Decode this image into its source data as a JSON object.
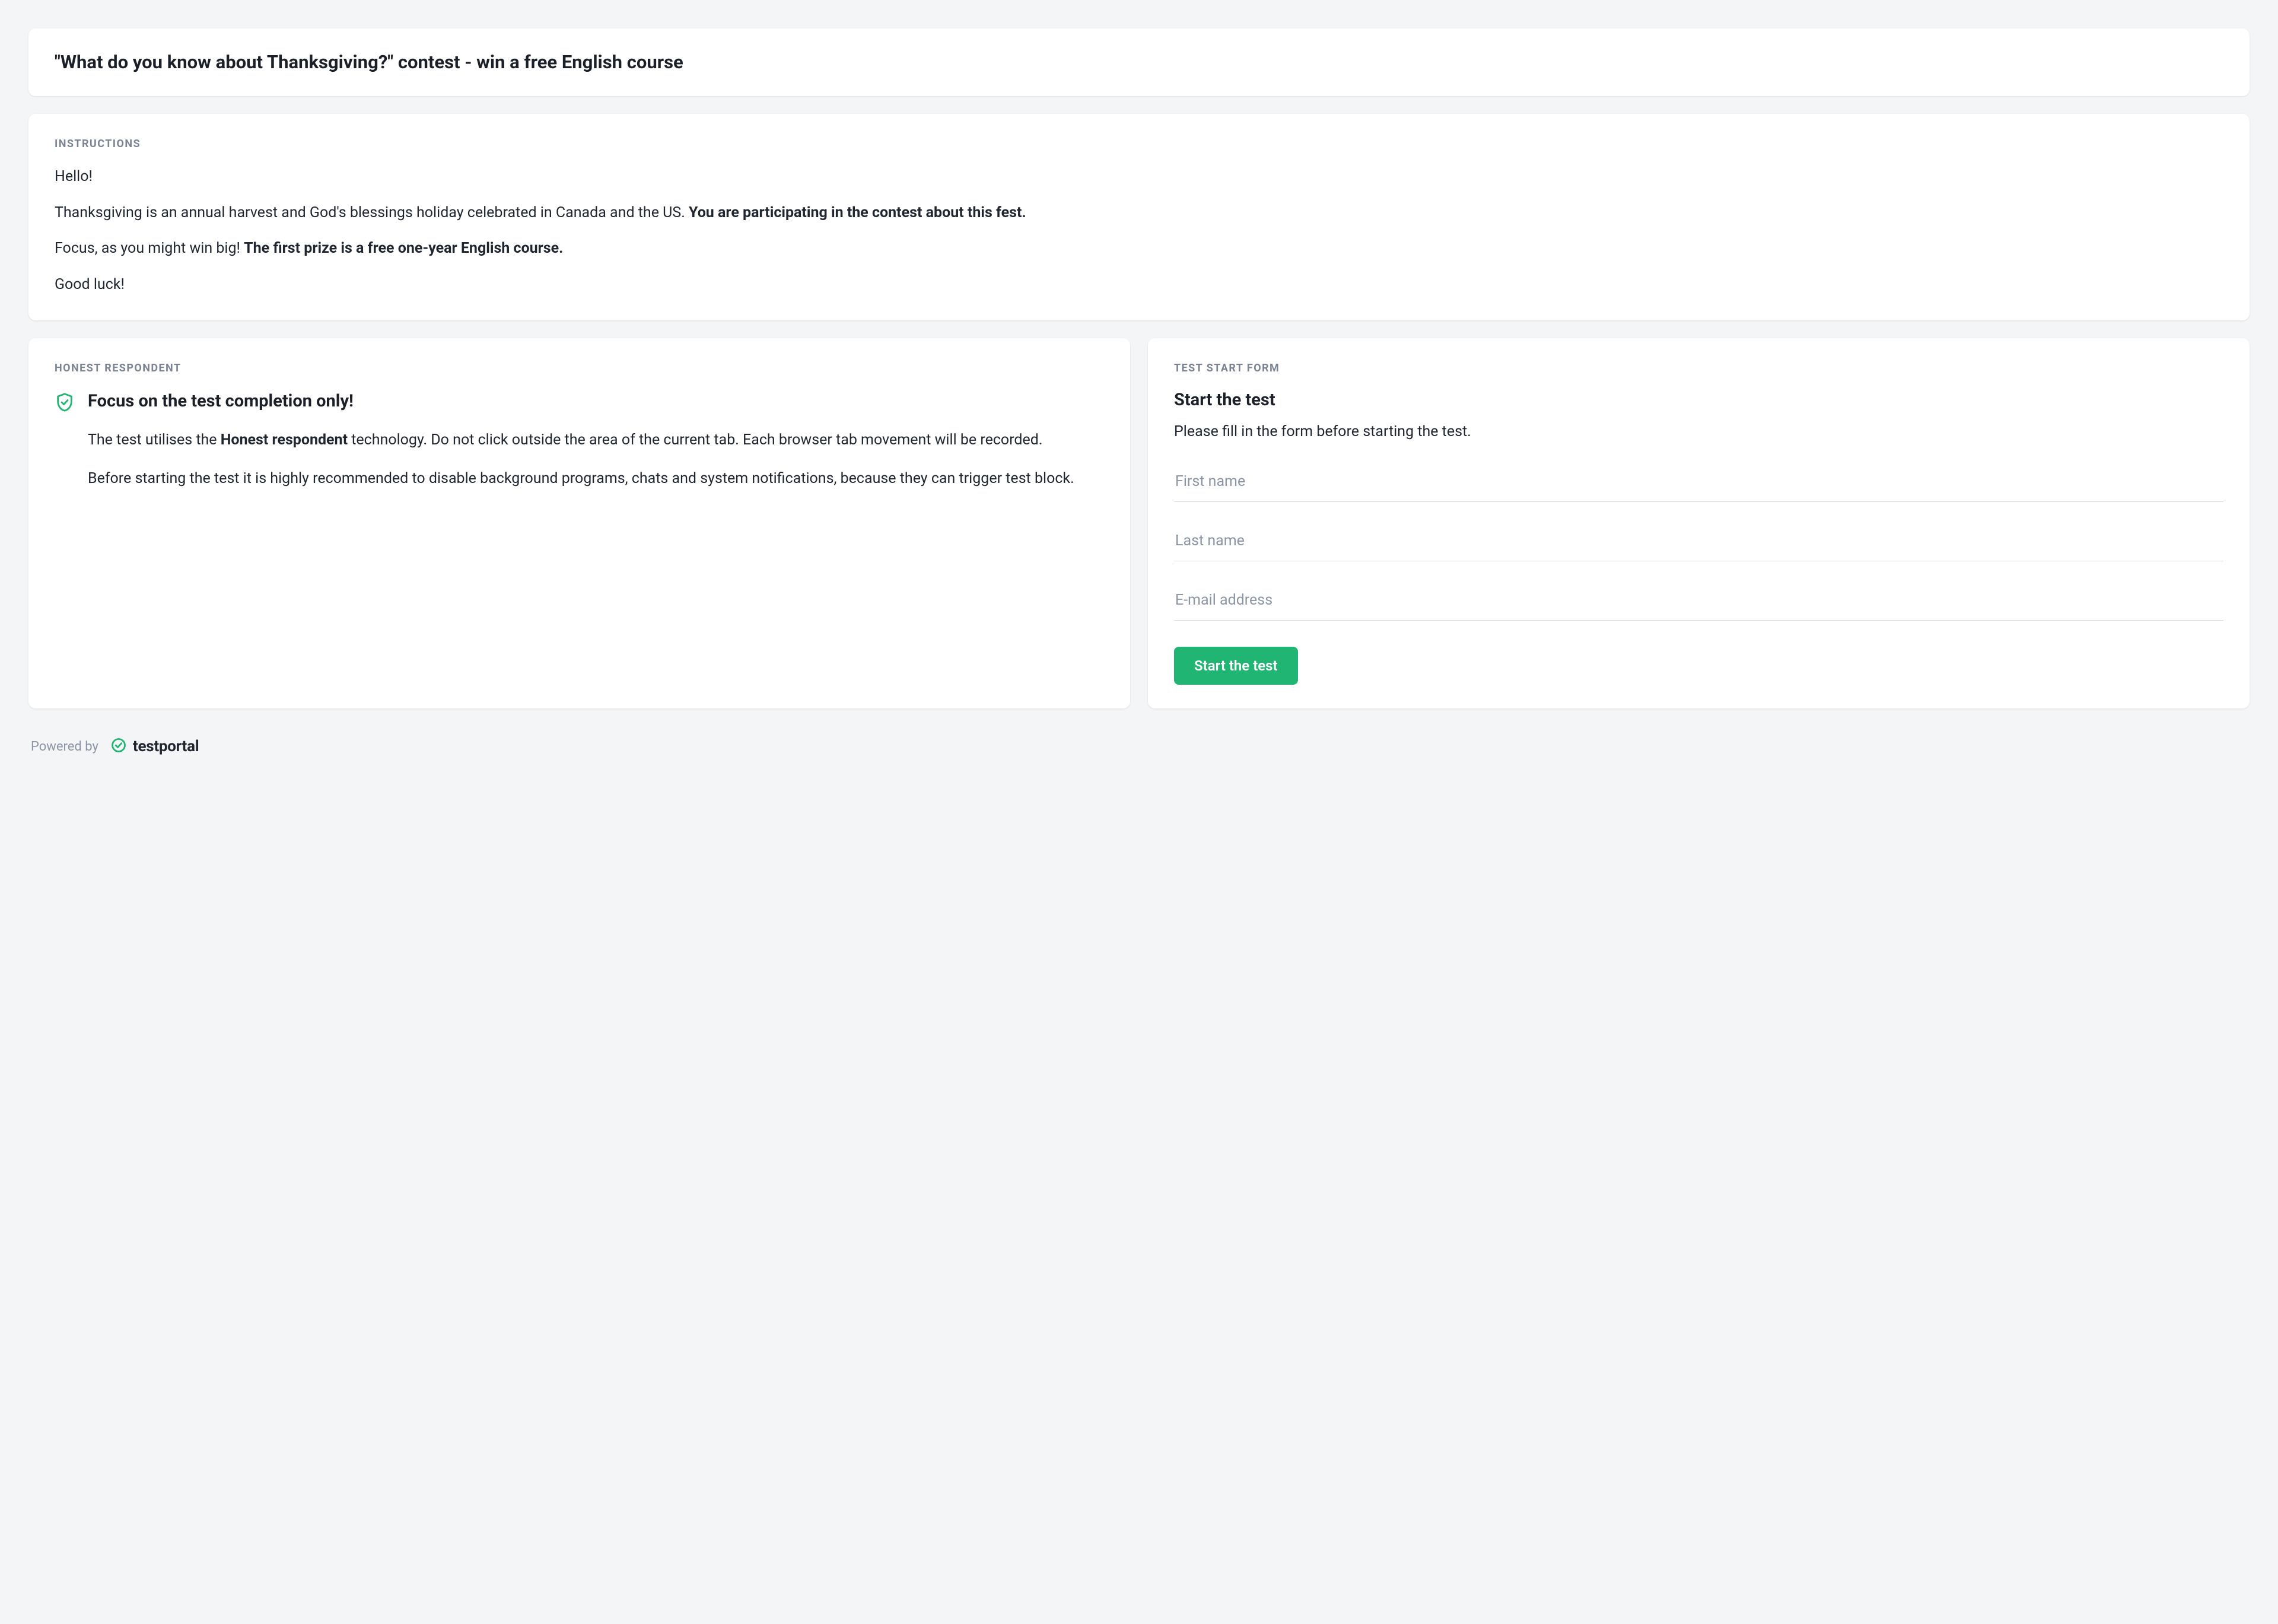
{
  "title": "\"What do you know about Thanksgiving?\" contest - win a free English course",
  "instructions": {
    "label": "INSTRUCTIONS",
    "p1": "Hello!",
    "p2a": "Thanksgiving is an annual harvest and God's blessings holiday celebrated in Canada and the US. ",
    "p2b": "You are participating in the contest about this fest.",
    "p3a": "Focus, as you might win big! ",
    "p3b": "The first prize is a free one-year English course.",
    "p4": "Good luck!"
  },
  "honest": {
    "label": "HONEST RESPONDENT",
    "title": "Focus on the test completion only!",
    "p1a": "The test utilises the ",
    "p1b": "Honest respondent",
    "p1c": " technology. Do not click outside the area of the current tab. Each browser tab movement will be recorded.",
    "p2": "Before starting the test it is highly recommended to disable background programs, chats and system notifications, because they can trigger test block.",
    "icon": "shield-check-icon"
  },
  "form": {
    "label": "TEST START FORM",
    "title": "Start the test",
    "subtitle": "Please fill in the form before starting the test.",
    "first_name_placeholder": "First name",
    "last_name_placeholder": "Last name",
    "email_placeholder": "E-mail address",
    "first_name_value": "",
    "last_name_value": "",
    "email_value": "",
    "start_label": "Start the test"
  },
  "footer": {
    "powered_by": "Powered by",
    "brand": "testportal",
    "accent": "#21b573"
  }
}
